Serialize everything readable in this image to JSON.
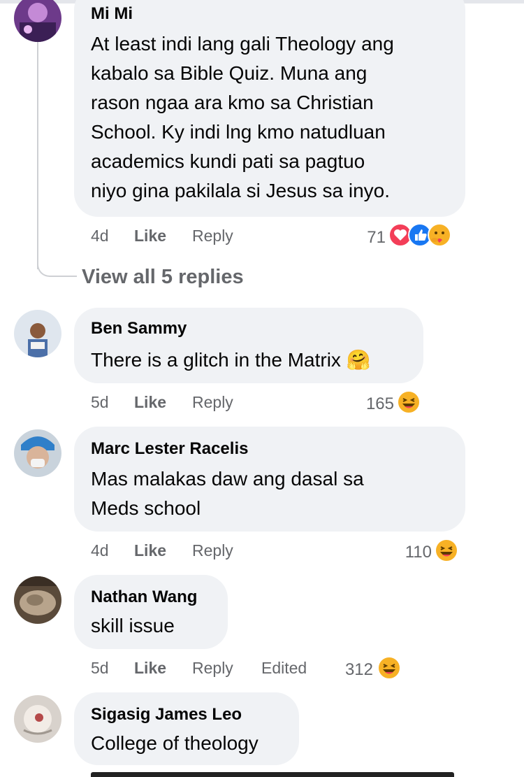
{
  "comments": [
    {
      "author": "Mi Mi",
      "text": [
        "At least indi lang gali Theology ang",
        "kabalo sa Bible Quiz. Muna ang",
        "rason ngaa ara kmo sa Christian",
        "School. Ky indi lng kmo natudluan",
        "academics kundi pati sa pagtuo",
        "niyo gina pakilala si Jesus sa inyo."
      ],
      "time": "4d",
      "like": "Like",
      "reply": "Reply",
      "edited": "",
      "reaction_count": "71",
      "reactions": [
        "love",
        "like",
        "care"
      ]
    },
    {
      "author": "Ben Sammy",
      "text": [
        "There is a glitch in the Matrix 🤗"
      ],
      "time": "5d",
      "like": "Like",
      "reply": "Reply",
      "edited": "",
      "reaction_count": "165",
      "reactions": [
        "haha"
      ]
    },
    {
      "author": "Marc Lester Racelis",
      "text": [
        "Mas malakas daw ang dasal sa",
        "Meds school"
      ],
      "time": "4d",
      "like": "Like",
      "reply": "Reply",
      "edited": "",
      "reaction_count": "110",
      "reactions": [
        "haha"
      ]
    },
    {
      "author": "Nathan Wang",
      "text": [
        "skill issue"
      ],
      "time": "5d",
      "like": "Like",
      "reply": "Reply",
      "edited": "Edited",
      "reaction_count": "312",
      "reactions": [
        "haha"
      ]
    },
    {
      "author": "Sigasig James Leo",
      "text": [
        "College of theology"
      ],
      "time": "",
      "like": "",
      "reply": "",
      "edited": "",
      "reaction_count": "",
      "reactions": []
    }
  ],
  "view_replies": "View all 5 replies",
  "colors": {
    "bubble": "#f0f2f5",
    "secondary_text": "#65676b",
    "love": "#f33e58",
    "like": "#1877f2",
    "haha": "#f7b125"
  }
}
